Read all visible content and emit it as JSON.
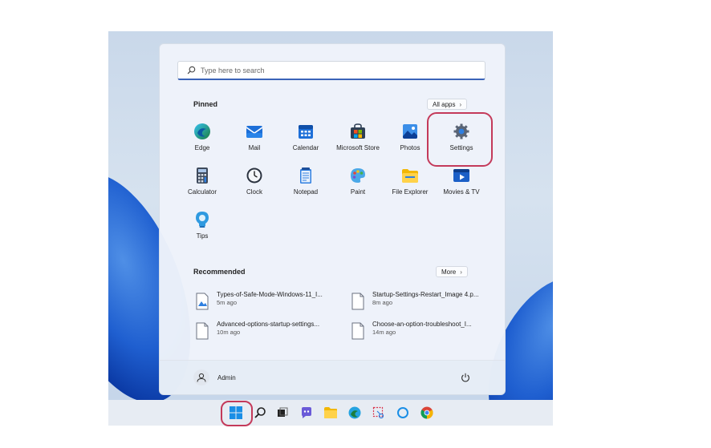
{
  "search": {
    "placeholder": "Type here to search"
  },
  "pinned": {
    "title": "Pinned",
    "all_apps_label": "All apps",
    "apps": [
      {
        "label": "Edge",
        "icon": "edge-icon"
      },
      {
        "label": "Mail",
        "icon": "mail-icon"
      },
      {
        "label": "Calendar",
        "icon": "calendar-icon"
      },
      {
        "label": "Microsoft Store",
        "icon": "store-icon"
      },
      {
        "label": "Photos",
        "icon": "photos-icon"
      },
      {
        "label": "Settings",
        "icon": "gear-icon"
      },
      {
        "label": "Calculator",
        "icon": "calculator-icon"
      },
      {
        "label": "Clock",
        "icon": "clock-icon"
      },
      {
        "label": "Notepad",
        "icon": "notepad-icon"
      },
      {
        "label": "Paint",
        "icon": "paint-icon"
      },
      {
        "label": "File Explorer",
        "icon": "folder-icon"
      },
      {
        "label": "Movies & TV",
        "icon": "movies-icon"
      },
      {
        "label": "Tips",
        "icon": "tips-icon"
      }
    ]
  },
  "recommended": {
    "title": "Recommended",
    "more_label": "More",
    "items": [
      {
        "name": "Types-of-Safe-Mode-Windows-11_I...",
        "time": "5m ago",
        "icon": "image-file-icon"
      },
      {
        "name": "Startup-Settings-Restart_Image 4.p...",
        "time": "8m ago",
        "icon": "document-icon"
      },
      {
        "name": "Advanced-options-startup-settings...",
        "time": "10m ago",
        "icon": "document-icon"
      },
      {
        "name": "Choose-an-option-troubleshoot_I...",
        "time": "14m ago",
        "icon": "document-icon"
      }
    ]
  },
  "footer": {
    "user": "Admin"
  },
  "colors": {
    "accent": "#0078d4",
    "highlight": "#c43a5a",
    "wallpaper_blue": "#1f5fd0"
  },
  "taskbar": [
    "windows-start-icon",
    "search-icon",
    "task-view-icon",
    "chat-icon",
    "folder-icon",
    "edge-icon",
    "snipping-tool-icon",
    "cortana-icon",
    "chrome-icon"
  ]
}
